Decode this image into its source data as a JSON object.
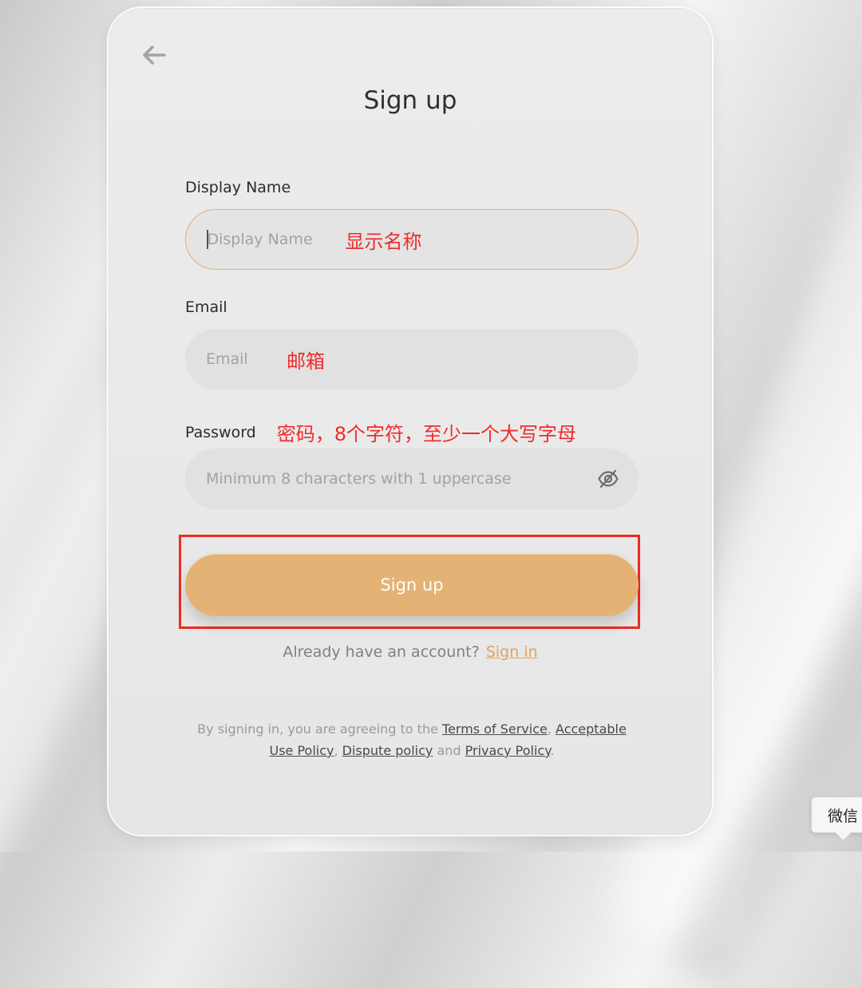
{
  "page": {
    "title": "Sign up"
  },
  "form": {
    "display_name": {
      "label": "Display Name",
      "placeholder": "Display Name",
      "annotation": "显示名称",
      "value": ""
    },
    "email": {
      "label": "Email",
      "placeholder": "Email",
      "annotation": "邮箱",
      "value": ""
    },
    "password": {
      "label": "Password",
      "placeholder": "Minimum 8 characters with 1 uppercase",
      "annotation": "密码，8个字符，至少一个大写字母",
      "value": "",
      "visibility_icon": "eye-off-icon"
    },
    "submit_label": "Sign up"
  },
  "signin_prompt": {
    "text": "Already have an account?",
    "link": "Sign in"
  },
  "legal": {
    "prefix": "By signing in, you are agreeing to the",
    "terms": "Terms of Service",
    "acceptable": "Acceptable Use Policy",
    "dispute": "Dispute policy",
    "and": "and",
    "privacy": "Privacy Policy"
  },
  "tooltip": {
    "text": "微信"
  },
  "icons": {
    "back": "arrow-left-icon",
    "password_toggle": "eye-off-icon"
  },
  "colors": {
    "accent": "#e4b274",
    "link": "#e2a35c",
    "annotation": "#f02b2b",
    "focus_border": "#e2b06c",
    "highlight_box": "#ee2b1f"
  }
}
